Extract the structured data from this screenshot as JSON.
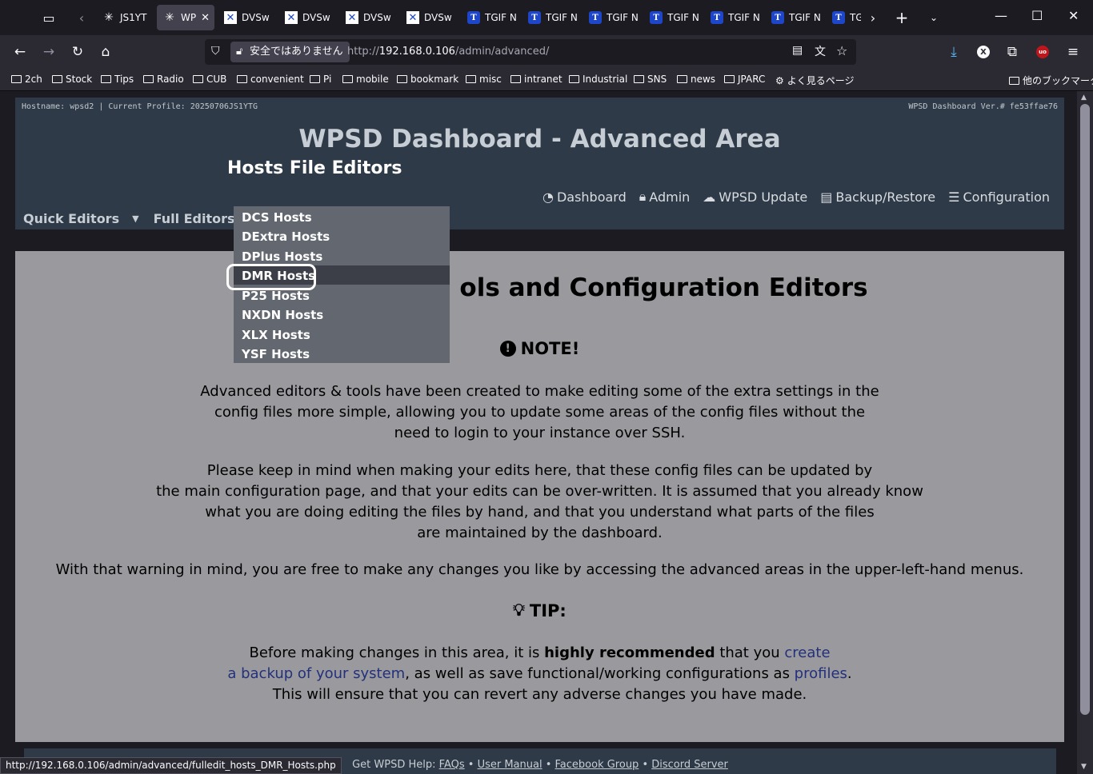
{
  "browser": {
    "tabs": [
      {
        "label": "JS1YT",
        "favicon": "snowflake",
        "active": false
      },
      {
        "label": "WP",
        "favicon": "snowflake",
        "active": true
      },
      {
        "label": "DVSw",
        "favicon": "x",
        "active": false
      },
      {
        "label": "DVSw",
        "favicon": "x",
        "active": false
      },
      {
        "label": "DVSw",
        "favicon": "x",
        "active": false
      },
      {
        "label": "DVSw",
        "favicon": "x",
        "active": false
      },
      {
        "label": "TGIF N",
        "favicon": "t",
        "active": false
      },
      {
        "label": "TGIF N",
        "favicon": "t",
        "active": false
      },
      {
        "label": "TGIF N",
        "favicon": "t",
        "active": false
      },
      {
        "label": "TGIF N",
        "favicon": "t",
        "active": false
      },
      {
        "label": "TGIF N",
        "favicon": "t",
        "active": false
      },
      {
        "label": "TGIF N",
        "favicon": "t",
        "active": false
      },
      {
        "label": "TG",
        "favicon": "t",
        "active": false
      }
    ],
    "security_warning": "安全ではありません",
    "url_prefix": "http://",
    "url_host": "192.168.0.106",
    "url_path": "/admin/advanced/",
    "bookmarks": [
      "2ch",
      "Stock",
      "Tips",
      "Radio",
      "CUB",
      "convenient",
      "Pi",
      "mobile",
      "bookmark",
      "misc",
      "intranet",
      "Industrial",
      "SNS",
      "news",
      "JPARC"
    ],
    "bookmark_most_visited": "よく見るページ",
    "bookmark_other": "他のブックマーク",
    "status_url": "http://192.168.0.106/admin/advanced/fulledit_hosts_DMR_Hosts.php"
  },
  "header": {
    "hostname_line": "Hostname: wpsd2 | Current Profile: 20250706JS1YTG",
    "version_line": "WPSD Dashboard Ver.# fe53ffae76",
    "title": "WPSD Dashboard - Advanced Area",
    "subtitle": "Hosts File Editors",
    "nav": [
      {
        "label": "Dashboard",
        "icon": "dashboard-icon"
      },
      {
        "label": "Admin",
        "icon": "lock-icon"
      },
      {
        "label": "WPSD Update",
        "icon": "cloud-download-icon"
      },
      {
        "label": "Backup/Restore",
        "icon": "archive-icon"
      },
      {
        "label": "Configuration",
        "icon": "sliders-icon"
      }
    ],
    "subnav": [
      {
        "label": "Quick Editors"
      },
      {
        "label": "Full Editors"
      }
    ]
  },
  "dropdown": {
    "items": [
      "DCS Hosts",
      "DExtra Hosts",
      "DPlus Hosts",
      "DMR Hosts",
      "P25 Hosts",
      "NXDN Hosts",
      "XLX Hosts",
      "YSF Hosts"
    ],
    "hovered": "DMR Hosts"
  },
  "content": {
    "heading": "ols and Configuration Editors",
    "note_title": "NOTE!",
    "note_p1": [
      "Advanced editors & tools have been created to make editing some of the extra settings in the",
      "config files more simple, allowing you to update some areas of the config files without the",
      "need to login to your instance over SSH."
    ],
    "note_p2": [
      "Please keep in mind when making your edits here, that these config files can be updated by",
      "the main configuration page, and that your edits can be over-written. It is assumed that you already know",
      "what you are doing editing the files by hand, and that you understand what parts of the files",
      "are maintained by the dashboard."
    ],
    "note_p3": "With that warning in mind, you are free to make any changes you like by accessing the advanced areas in the upper-left-hand menus.",
    "tip_title": "TIP:",
    "tip_a": "Before making changes in this area, it is ",
    "tip_bold": "highly recommended",
    "tip_b": " that you ",
    "tip_link1a": "create",
    "tip_link1b": "a backup of your system",
    "tip_c": ", as well as save functional/working configurations as ",
    "tip_link2": "profiles",
    "tip_d": ".",
    "tip_e": "This will ensure that you can revert any adverse changes you have made."
  },
  "footer": {
    "prefix": "Get WPSD Help: ",
    "links": [
      "FAQs",
      "User Manual",
      "Facebook Group",
      "Discord Server"
    ],
    "sep": " • "
  },
  "colors": {
    "header_bg": "#2e3a47",
    "content_bg": "#9a9a9e",
    "dropdown_bg": "#626770",
    "dropdown_hover": "#3c3f47",
    "link": "#23307a"
  }
}
